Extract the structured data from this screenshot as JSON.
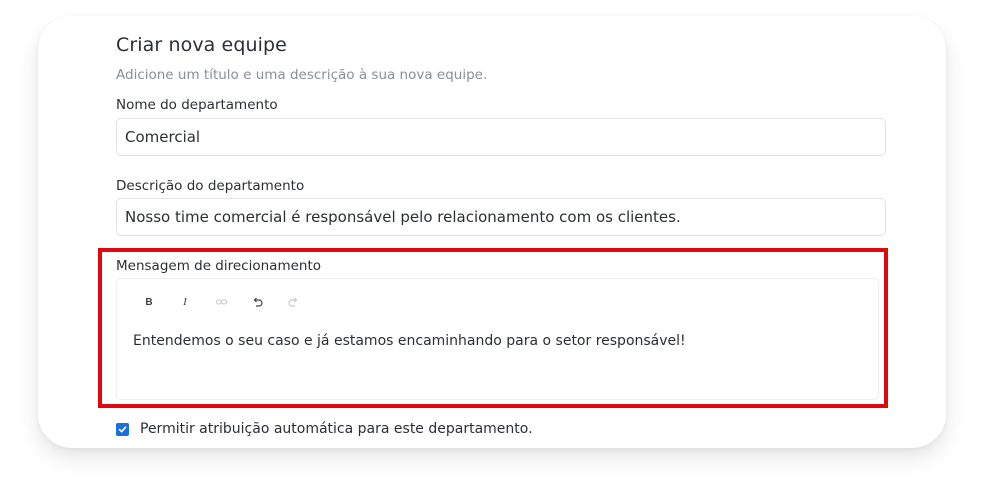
{
  "form": {
    "title": "Criar nova equipe",
    "subtitle": "Adicione um título e uma descrição à sua nova equipe.",
    "department_name": {
      "label": "Nome do departamento",
      "value": "Comercial"
    },
    "department_description": {
      "label": "Descrição do departamento",
      "value": "Nosso time comercial é responsável pelo relacionamento com os clientes."
    },
    "routing_message": {
      "label": "Mensagem de direcionamento",
      "value": "Entendemos o seu caso e já estamos encaminhando para o setor responsável!",
      "toolbar": {
        "bold_label": "B",
        "italic_label": "I"
      }
    },
    "auto_assign": {
      "label": "Permitir atribuição automática para este departamento.",
      "checked": true
    }
  },
  "colors": {
    "highlight": "#e0080d",
    "checkbox": "#1b6fd6"
  }
}
